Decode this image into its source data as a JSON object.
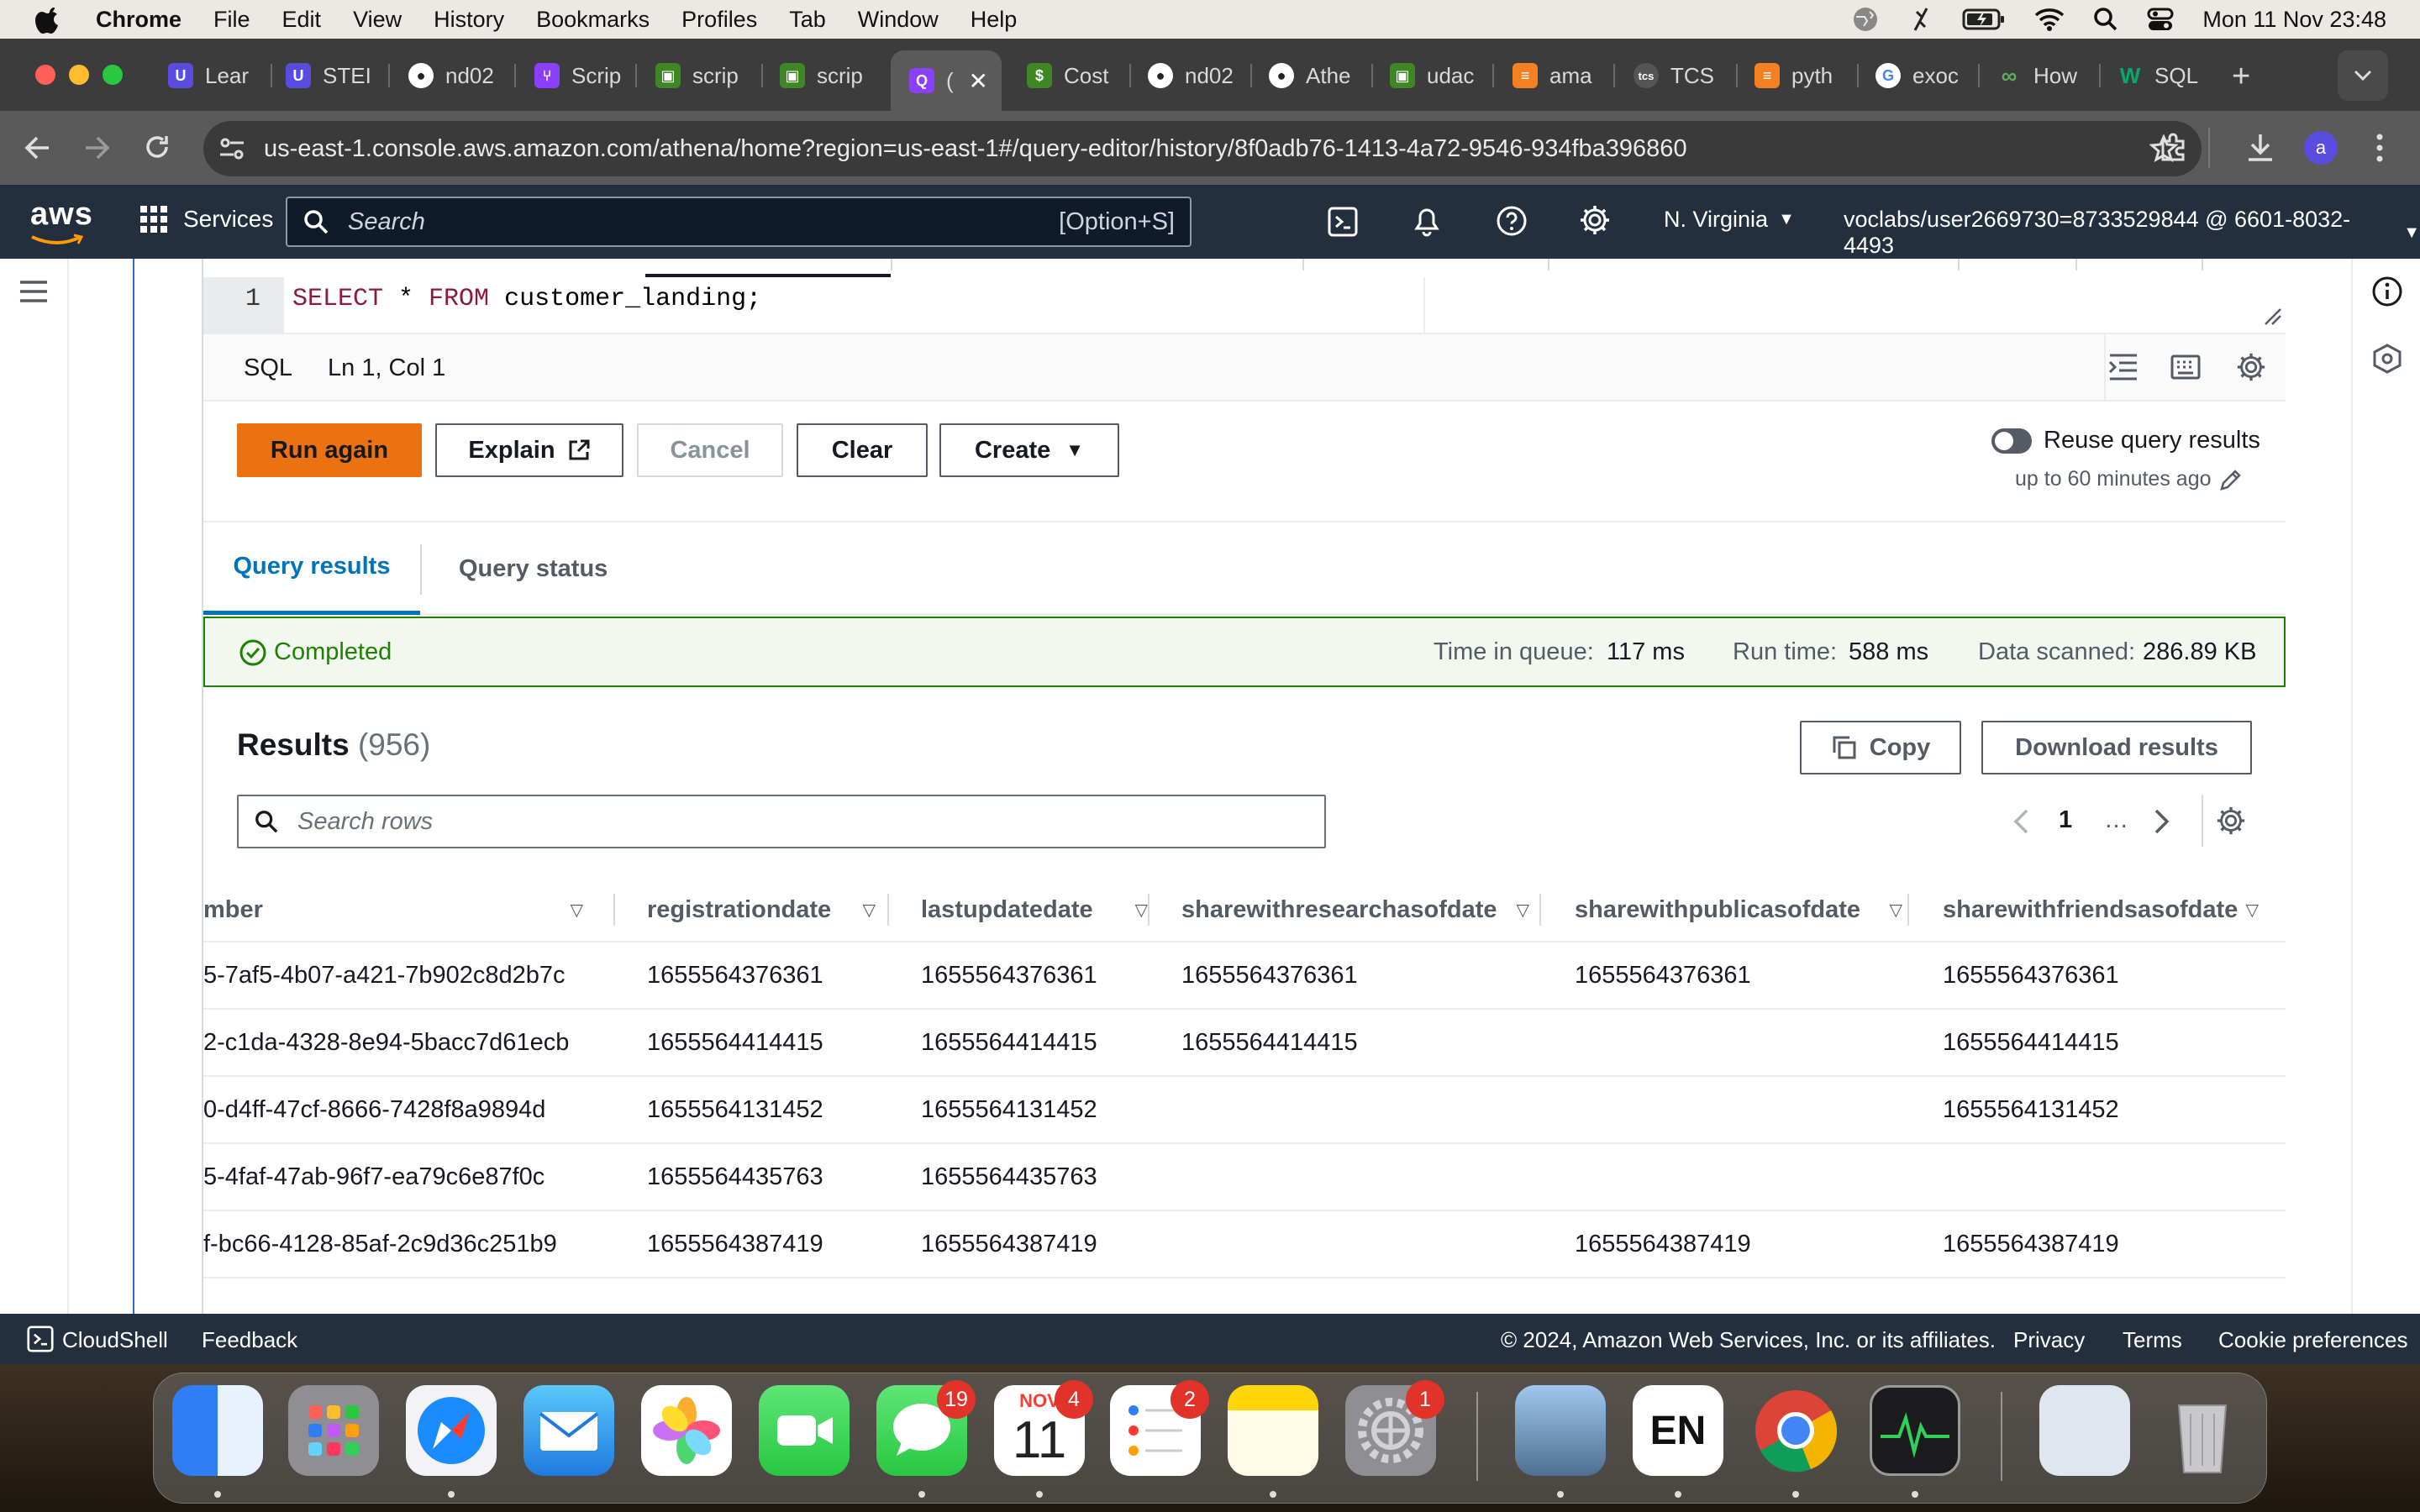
{
  "menubar": {
    "app": "Chrome",
    "items": [
      "File",
      "Edit",
      "View",
      "History",
      "Bookmarks",
      "Profiles",
      "Tab",
      "Window",
      "Help"
    ],
    "clock": "Mon 11 Nov  23:48"
  },
  "browser": {
    "tabs": [
      {
        "label": "Lear",
        "icon": "udacity-icon",
        "color": "#5b4ce0"
      },
      {
        "label": "STEI",
        "icon": "udacity-icon",
        "color": "#5b4ce0"
      },
      {
        "label": "nd02",
        "icon": "github-icon",
        "color": "#222222"
      },
      {
        "label": "Scrip",
        "icon": "step-icon",
        "color": "#8a3ffc"
      },
      {
        "label": "scrip",
        "icon": "aws-glue-icon",
        "color": "#3f8624"
      },
      {
        "label": "scrip",
        "icon": "aws-glue-icon",
        "color": "#3f8624"
      },
      {
        "label": "(",
        "icon": "athena-icon",
        "color": "#8a3ffc"
      },
      {
        "label": "Cost",
        "icon": "aws-cost-icon",
        "color": "#3f8624"
      },
      {
        "label": "nd02",
        "icon": "github-icon",
        "color": "#222222"
      },
      {
        "label": "Athe",
        "icon": "github-icon",
        "color": "#222222"
      },
      {
        "label": "udac",
        "icon": "aws-glue-icon",
        "color": "#3f8624"
      },
      {
        "label": "ama",
        "icon": "stackoverflow-icon",
        "color": "#f48024"
      },
      {
        "label": "TCS",
        "icon": "tcs-icon",
        "color": "#555555"
      },
      {
        "label": "pyth",
        "icon": "stackoverflow-icon",
        "color": "#f48024"
      },
      {
        "label": "exoc",
        "icon": "google-icon",
        "color": "#ffffff"
      },
      {
        "label": "How",
        "icon": "infinity-icon",
        "color": "#3a6a3a"
      },
      {
        "label": "SQL",
        "icon": "w3schools-icon",
        "color": "#04aa6d"
      }
    ],
    "url": "us-east-1.console.aws.amazon.com/athena/home?region=us-east-1#/query-editor/history/8f0adb76-1413-4a72-9546-934fba396860",
    "profile_initial": "a"
  },
  "aws": {
    "logo": "aws",
    "services_label": "Services",
    "search_placeholder": "Search",
    "search_shortcut": "[Option+S]",
    "region": "N. Virginia",
    "account": "voclabs/user2669730=8733529844 @ 6601-8032-4493"
  },
  "editor": {
    "line_number": "1",
    "keyword_select": "SELECT",
    "code_middle": " * ",
    "keyword_from": "FROM",
    "code_rest": " customer_landing;",
    "language": "SQL",
    "cursor_pos": "Ln 1, Col 1"
  },
  "actions": {
    "run_again": "Run again",
    "explain": "Explain",
    "cancel": "Cancel",
    "clear": "Clear",
    "create": "Create",
    "reuse_label": "Reuse query results",
    "reuse_sub": "up to 60 minutes ago"
  },
  "query_tabs": {
    "results": "Query results",
    "status": "Query status"
  },
  "status": {
    "state": "Completed",
    "queue_label": "Time in queue:",
    "queue_value": "117 ms",
    "run_label": "Run time:",
    "run_value": "588 ms",
    "scanned_label": "Data scanned:",
    "scanned_value": "286.89 KB"
  },
  "results": {
    "title": "Results",
    "count": "(956)",
    "copy": "Copy",
    "download": "Download results",
    "search_placeholder": "Search rows",
    "page": "1",
    "ellipsis": "…",
    "columns": [
      "mber",
      "registrationdate",
      "lastupdatedate",
      "sharewithresearchasofdate",
      "sharewithpublicasofdate",
      "sharewithfriendsasofdate"
    ],
    "rows": [
      [
        "5-7af5-4b07-a421-7b902c8d2b7c",
        "1655564376361",
        "1655564376361",
        "1655564376361",
        "1655564376361",
        "1655564376361"
      ],
      [
        "2-c1da-4328-8e94-5bacc7d61ecb",
        "1655564414415",
        "1655564414415",
        "1655564414415",
        "",
        "1655564414415"
      ],
      [
        "0-d4ff-47cf-8666-7428f8a9894d",
        "1655564131452",
        "1655564131452",
        "",
        "",
        "1655564131452"
      ],
      [
        "5-4faf-47ab-96f7-ea79c6e87f0c",
        "1655564435763",
        "1655564435763",
        "",
        "",
        ""
      ],
      [
        "f-bc66-4128-85af-2c9d36c251b9",
        "1655564387419",
        "1655564387419",
        "",
        "1655564387419",
        "1655564387419"
      ]
    ]
  },
  "footer": {
    "cloudshell": "CloudShell",
    "feedback": "Feedback",
    "copyright": "© 2024, Amazon Web Services, Inc. or its affiliates.",
    "privacy": "Privacy",
    "terms": "Terms",
    "cookies": "Cookie preferences"
  },
  "dock": {
    "messages_badge": "19",
    "calendar_month": "NOV",
    "calendar_day": "11",
    "calendar_badge": "4",
    "reminders_badge": "2",
    "settings_badge": "1",
    "keyboard_label": "EN"
  }
}
